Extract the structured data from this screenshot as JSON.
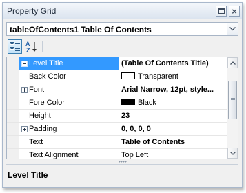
{
  "window": {
    "title": "Property Grid"
  },
  "selector": {
    "text": "tableOfContents1   Table Of Contents"
  },
  "toolbar": {
    "categorized_label": "Categorized",
    "alphabetical_label": "Alphabetical"
  },
  "grid": {
    "rows": [
      {
        "name": "Level Title",
        "value": "(Table Of Contents Title)",
        "expander": "minus",
        "selected": true,
        "bold": true
      },
      {
        "name": "Back Color",
        "value": "Transparent",
        "swatch": "transparent"
      },
      {
        "name": "Font",
        "value": "Arial Narrow, 12pt, style...",
        "expander": "plus",
        "bold": true
      },
      {
        "name": "Fore Color",
        "value": "Black",
        "swatch": "black"
      },
      {
        "name": "Height",
        "value": "23",
        "bold": true
      },
      {
        "name": "Padding",
        "value": "0, 0, 0, 0",
        "expander": "plus",
        "bold": true
      },
      {
        "name": "Text",
        "value": "Table of Contents",
        "bold": true
      },
      {
        "name": "Text Alignment",
        "value": "Top Left"
      }
    ]
  },
  "description": {
    "title": "Level Title"
  },
  "colors": {
    "selection": "#3399ff",
    "panel_border": "#a9b8cc",
    "background": "#f0f0f0"
  }
}
